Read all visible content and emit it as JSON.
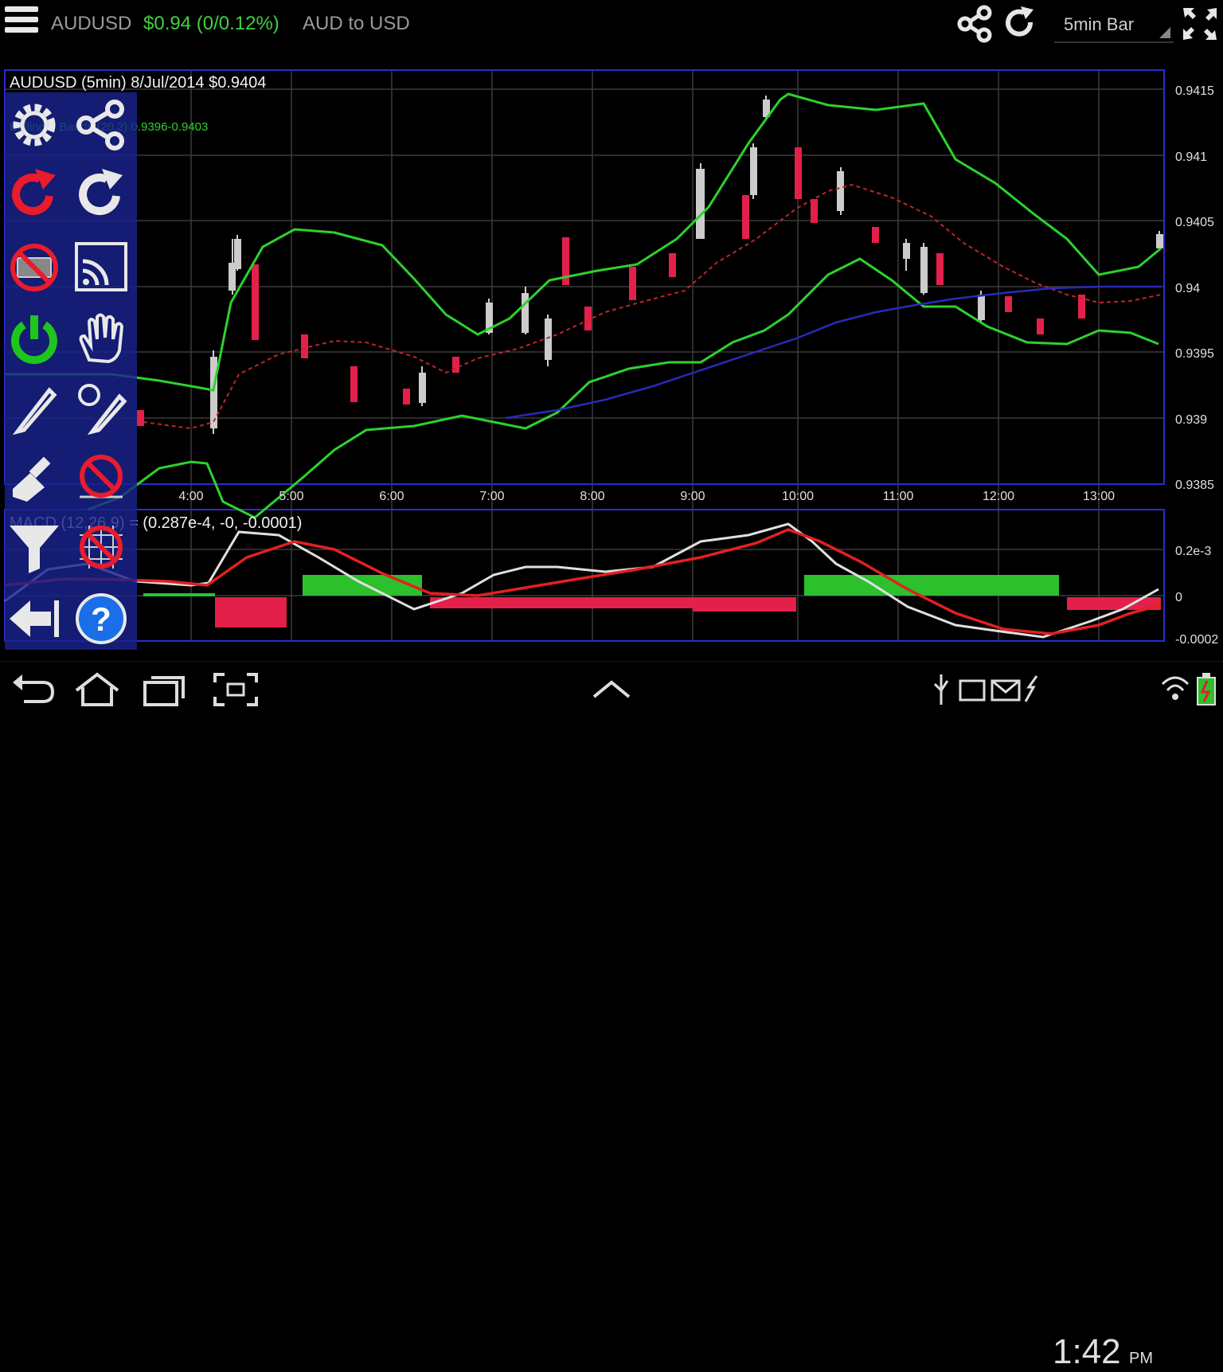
{
  "header": {
    "symbol": "AUDUSD",
    "price": "$0.94 (0/0.12%)",
    "description": "AUD to USD",
    "bar_period": "5min Bar",
    "price_color": "#3fd23f"
  },
  "chart": {
    "title": "AUDUSD (5min) 8/Jul/2014 $0.9404",
    "bollinger_label": "Bollinger Bands (20,2) 0.9396-0.9403",
    "macd_label": "MACD (12,26,9) = (0.287e-4, -0, -0.0001)",
    "price_ticks": [
      "0.9415",
      "0.941",
      "0.9405",
      "0.94",
      "0.9395",
      "0.939",
      "0.9385"
    ],
    "macd_ticks": [
      "0.2e-3",
      "0",
      "-0.0002"
    ],
    "time_ticks": [
      "4:00",
      "5:00",
      "6:00",
      "7:00",
      "8:00",
      "9:00",
      "10:00",
      "11:00",
      "12:00",
      "13:00"
    ]
  },
  "toolbar": {
    "icons": [
      "settings-icon",
      "share-icon",
      "refresh-red-icon",
      "refresh-icon",
      "no-ads-icon",
      "news-feed-icon",
      "power-icon",
      "hand-pan-icon",
      "draw-tool-icon",
      "draw-circle-icon",
      "clear-drawing-icon",
      "delete-drawing-icon",
      "filter-icon",
      "no-grid-icon",
      "back-arrow-icon",
      "help-icon"
    ]
  },
  "statusbar": {
    "time": "1:42",
    "ampm": "PM"
  }
}
